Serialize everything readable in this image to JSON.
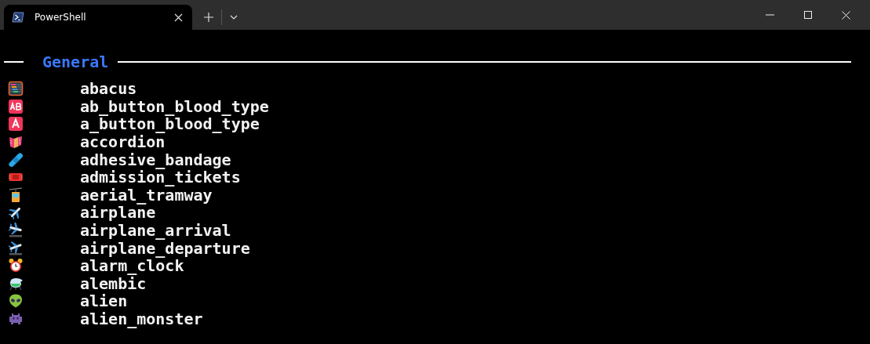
{
  "window": {
    "tabs": [
      {
        "title": "PowerShell",
        "selected": true
      }
    ]
  },
  "section": {
    "title": "General"
  },
  "entries": [
    {
      "name": "abacus"
    },
    {
      "name": "ab_button_blood_type"
    },
    {
      "name": "a_button_blood_type"
    },
    {
      "name": "accordion"
    },
    {
      "name": "adhesive_bandage"
    },
    {
      "name": "admission_tickets"
    },
    {
      "name": "aerial_tramway"
    },
    {
      "name": "airplane"
    },
    {
      "name": "airplane_arrival"
    },
    {
      "name": "airplane_departure"
    },
    {
      "name": "alarm_clock"
    },
    {
      "name": "alembic"
    },
    {
      "name": "alien"
    },
    {
      "name": "alien_monster"
    }
  ]
}
